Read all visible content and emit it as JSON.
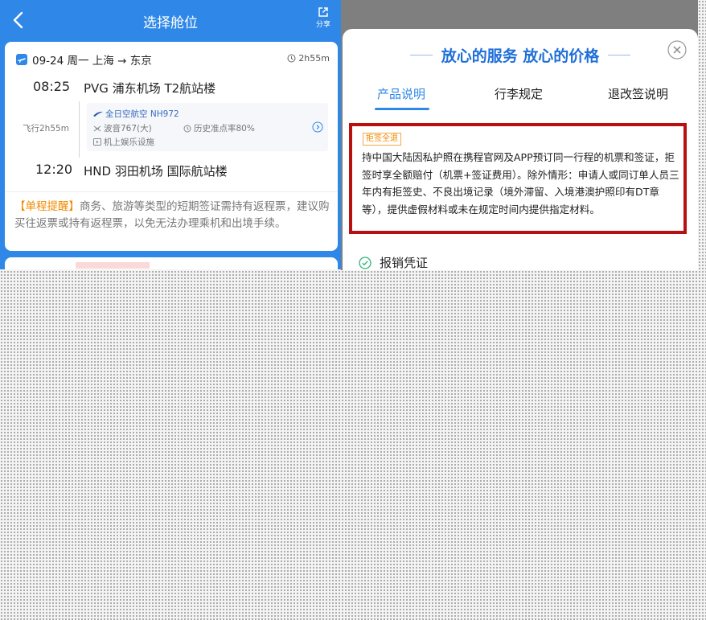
{
  "left_panel": {
    "header": {
      "title": "选择舱位",
      "share_label": "分享"
    },
    "flight": {
      "route": "09-24 周一  上海 → 东京",
      "duration": "2h55m",
      "departure": {
        "time": "08:25",
        "airport": "PVG 浦东机场 T2航站楼"
      },
      "arrival": {
        "time": "12:20",
        "airport": "HND 羽田机场 国际航站楼"
      },
      "fly_time": "飞行2h55m",
      "airline": "全日空航空 NH972",
      "aircraft": "波音767(大)",
      "on_time": "历史准点率80%",
      "entertainment": "机上娱乐设施"
    },
    "reminder": {
      "tag": "【单程提醒】",
      "text": "商务、旅游等类型的短期签证需持有返程票，建议购买往返票或持有返程票，以免无法办理乘机和出境手续。"
    }
  },
  "right_panel": {
    "title": "放心的服务 放心的价格",
    "tabs": [
      "产品说明",
      "行李规定",
      "退改签说明"
    ],
    "active_tab": "产品说明",
    "refund_tag": "拒签全退",
    "refund_text": "持中国大陆因私护照在携程官网及APP预订同一行程的机票和签证，拒签时享全额赔付（机票+签证费用）。除外情形：申请人或同订单人员三年内有拒签史、不良出境记录（境外滞留、入境港澳护照印有DT章等），提供虚假材料或未在规定时间内提供指定材料。",
    "next_item": "报销凭证"
  },
  "colors": {
    "primary_blue": "#2f88e8",
    "highlight_red": "#b80f0f",
    "accent_orange": "#f08a00",
    "success_green": "#2fb57a"
  },
  "icons": [
    "back-arrow-icon",
    "share-icon",
    "plane-icon",
    "clock-icon",
    "airline-logo-icon",
    "aircraft-icon",
    "ontime-icon",
    "entertainment-icon",
    "chevron-right-icon",
    "close-icon",
    "check-circle-icon"
  ]
}
